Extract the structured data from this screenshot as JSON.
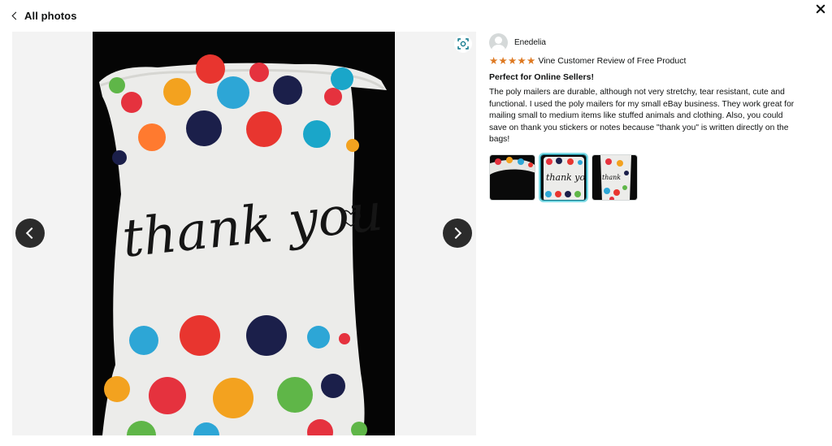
{
  "header": {
    "back_label": "All photos",
    "close_icon": "close-icon"
  },
  "viewer": {
    "photo_text": "thank you",
    "prev_icon": "chevron-left-icon",
    "next_icon": "chevron-right-icon",
    "zoom_icon": "expand-icon"
  },
  "review": {
    "reviewer_name": "Enedelia",
    "rating": 5,
    "rating_max": 5,
    "badge": "Vine Customer Review of Free Product",
    "title": "Perfect for Online Sellers!",
    "body": "The poly mailers are durable, although not very stretchy, tear resistant, cute and functional. I used the poly mailers for my small eBay business. They work great for mailing small to medium items like stuffed animals and clothing. Also, you could save on thank you stickers or notes because \"thank you\" is written directly on the bags!",
    "selected_thumbnail": 2,
    "thumbnail_count": 3
  },
  "colors": {
    "star": "#de7921",
    "nav_button": "#2b2b2b",
    "selected_outline": "#7fdbe5",
    "dot_colors": [
      "#e5323e",
      "#f3a21f",
      "#2da6d6",
      "#1b1f4a",
      "#5fb648",
      "#ff7a2f",
      "#e8352f",
      "#1aa6c9"
    ]
  }
}
